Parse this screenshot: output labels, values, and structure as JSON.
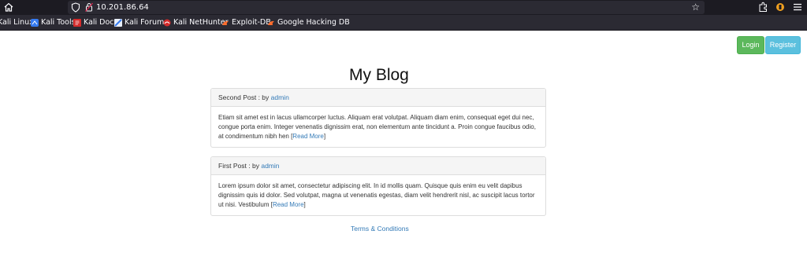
{
  "browser": {
    "url": "10.201.86.64",
    "bookmarks": [
      {
        "label": "Kali Linux",
        "icon": "kali-icon"
      },
      {
        "label": "Kali Tools",
        "icon": "kali-tools-icon"
      },
      {
        "label": "Kali Docs",
        "icon": "kali-docs-icon"
      },
      {
        "label": "Kali Forums",
        "icon": "kali-forums-icon"
      },
      {
        "label": "Kali NetHunter",
        "icon": "kali-nethunter-icon"
      },
      {
        "label": "Exploit-DB",
        "icon": "exploit-db-icon"
      },
      {
        "label": "Google Hacking DB",
        "icon": "google-hacking-db-icon"
      }
    ]
  },
  "header": {
    "login_label": "Login",
    "register_label": "Register"
  },
  "main": {
    "title": "My Blog",
    "posts": [
      {
        "title": "Second Post",
        "by_label": " : by ",
        "author": "admin",
        "body": "Etiam sit amet est in lacus ullamcorper luctus. Aliquam erat volutpat. Aliquam diam enim, consequat eget dui nec, congue porta enim. Integer venenatis dignissim erat, non elementum ante tincidunt a. Proin congue faucibus odio, at condimentum nibh hen ",
        "bracket_open": "[",
        "read_more": "Read More",
        "bracket_close": "]"
      },
      {
        "title": "First Post",
        "by_label": " : by ",
        "author": "admin",
        "body": "Lorem ipsum dolor sit amet, consectetur adipiscing elit. In id mollis quam. Quisque quis enim eu velit dapibus dignissim quis id dolor. Sed volutpat, magna ut venenatis egestas, diam velit hendrerit nisl, ac suscipit lacus tortor ut nisi. Vestibulum ",
        "bracket_open": "[",
        "read_more": "Read More",
        "bracket_close": "]"
      }
    ]
  },
  "footer": {
    "terms_label": "Terms & Conditions"
  },
  "colors": {
    "login": "#5cb85c",
    "register": "#5bc0de",
    "link": "#337ab7",
    "chrome_dark": "#1c1b22",
    "chrome_toolbar": "#2b2a33"
  }
}
